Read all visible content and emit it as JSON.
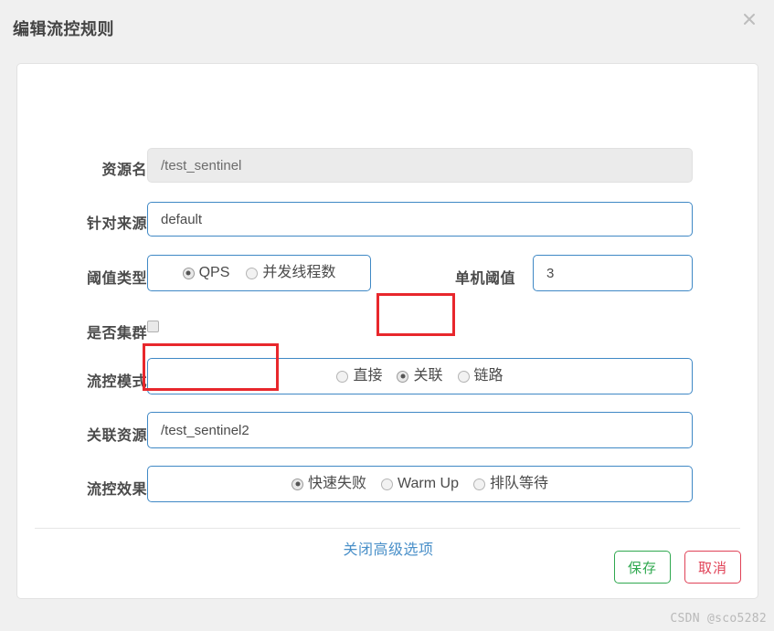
{
  "dialog": {
    "title": "编辑流控规则",
    "close_icon": "close-icon"
  },
  "form": {
    "resource_name": {
      "label": "资源名",
      "value": "/test_sentinel",
      "readonly": true
    },
    "limit_origin": {
      "label": "针对来源",
      "value": "default"
    },
    "threshold_type": {
      "label": "阈值类型",
      "options": [
        {
          "label": "QPS",
          "checked": true
        },
        {
          "label": "并发线程数",
          "checked": false
        }
      ]
    },
    "single_threshold": {
      "label": "单机阈值",
      "value": "3"
    },
    "is_cluster": {
      "label": "是否集群",
      "checked": false
    },
    "flow_mode": {
      "label": "流控模式",
      "options": [
        {
          "label": "直接",
          "checked": false
        },
        {
          "label": "关联",
          "checked": true
        },
        {
          "label": "链路",
          "checked": false
        }
      ]
    },
    "ref_resource": {
      "label": "关联资源",
      "value": "/test_sentinel2"
    },
    "flow_effect": {
      "label": "流控效果",
      "options": [
        {
          "label": "快速失败",
          "checked": true
        },
        {
          "label": "Warm Up",
          "checked": false
        },
        {
          "label": "排队等待",
          "checked": false
        }
      ]
    },
    "advanced_link": "关闭高级选项"
  },
  "footer": {
    "save_label": "保存",
    "cancel_label": "取消"
  },
  "watermark": "CSDN @sco5282",
  "colors": {
    "accent_blue": "#3f88c5",
    "link_blue": "#4a90c9",
    "annotation_red": "#e8272c",
    "save_green": "#2fa84f",
    "cancel_red": "#e04257",
    "page_background": "#f0f0f0"
  }
}
